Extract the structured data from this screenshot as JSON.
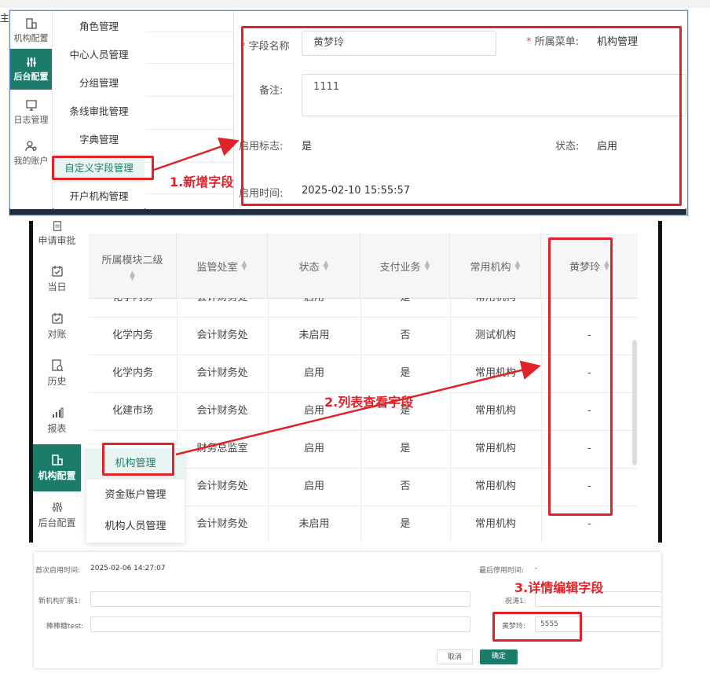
{
  "top_label": "主",
  "panel1": {
    "sidebar": [
      {
        "label": "机构配置",
        "icon": "org-icon"
      },
      {
        "label": "后台配置",
        "icon": "sliders-icon",
        "active": true
      },
      {
        "label": "日志管理",
        "icon": "monitor-icon"
      },
      {
        "label": "我的账户",
        "icon": "user-icon"
      }
    ],
    "menu": [
      "角色管理",
      "中心人员管理",
      "分组管理",
      "条线审批管理",
      "字典管理",
      "自定义字段管理",
      "开户机构管理"
    ],
    "form": {
      "field_name_label": "字段名称",
      "field_name_value": "黄梦玲",
      "menu_label": "所属菜单:",
      "menu_value": "机构管理",
      "note_label": "备注:",
      "note_value": "1111",
      "enable_flag_label": "启用标志:",
      "enable_flag_value": "是",
      "status_label": "状态:",
      "status_value": "启用",
      "enable_time_label": "启用时间:",
      "enable_time_value": "2025-02-10 15:55:57"
    }
  },
  "panel2": {
    "sidebar": [
      {
        "label": "申请审批",
        "icon": "doc-icon"
      },
      {
        "label": "当日",
        "icon": "calendar-check-icon"
      },
      {
        "label": "对账",
        "icon": "calendar-check-icon"
      },
      {
        "label": "历史",
        "icon": "history-icon"
      },
      {
        "label": "报表",
        "icon": "bar-chart-icon"
      },
      {
        "label": "机构配置",
        "icon": "org-icon",
        "active": true
      },
      {
        "label": "后台配置",
        "icon": "sliders-icon"
      }
    ],
    "columns": [
      "所属模块二级",
      "监管处室",
      "状态",
      "支付业务",
      "常用机构",
      "黄梦玲"
    ],
    "rows": [
      [
        "化学内务",
        "会计财务处",
        "启用",
        "是",
        "常用机构",
        "-"
      ],
      [
        "化学内务",
        "会计财务处",
        "未启用",
        "否",
        "测试机构",
        "-"
      ],
      [
        "化学内务",
        "会计财务处",
        "启用",
        "是",
        "常用机构",
        "-"
      ],
      [
        "化建市场",
        "会计财务处",
        "启用",
        "是",
        "常用机构",
        "-"
      ],
      [
        "",
        "财务总监室",
        "启用",
        "是",
        "常用机构",
        "-"
      ],
      [
        "",
        "会计财务处",
        "启用",
        "否",
        "常用机构",
        "-"
      ],
      [
        "",
        "会计财务处",
        "未启用",
        "是",
        "常用机构",
        "-"
      ]
    ],
    "popup_menu": [
      "机构管理",
      "资金账户管理",
      "机构人员管理"
    ]
  },
  "panel3": {
    "first_enable_label": "首次启用时间:",
    "first_enable_value": "2025-02-06 14:27:07",
    "last_disable_label": "最后停用时间:",
    "last_disable_value": "-",
    "ext1_label": "新机构扩展1:",
    "ext1_value": "",
    "zhuzhu_label": "祝涛1:",
    "test_label": "棒棒糖test:",
    "test_value": "",
    "hml_label": "黄梦玲:",
    "hml_value": "5555",
    "cancel_label": "取消",
    "confirm_label": "确定"
  },
  "annotations": {
    "step1": "1.新增字段",
    "step2": "2.列表查看字段",
    "step3": "3.详情编辑字段",
    "color": "#e0222a"
  },
  "theme": {
    "accent": "#1b7c6c"
  }
}
